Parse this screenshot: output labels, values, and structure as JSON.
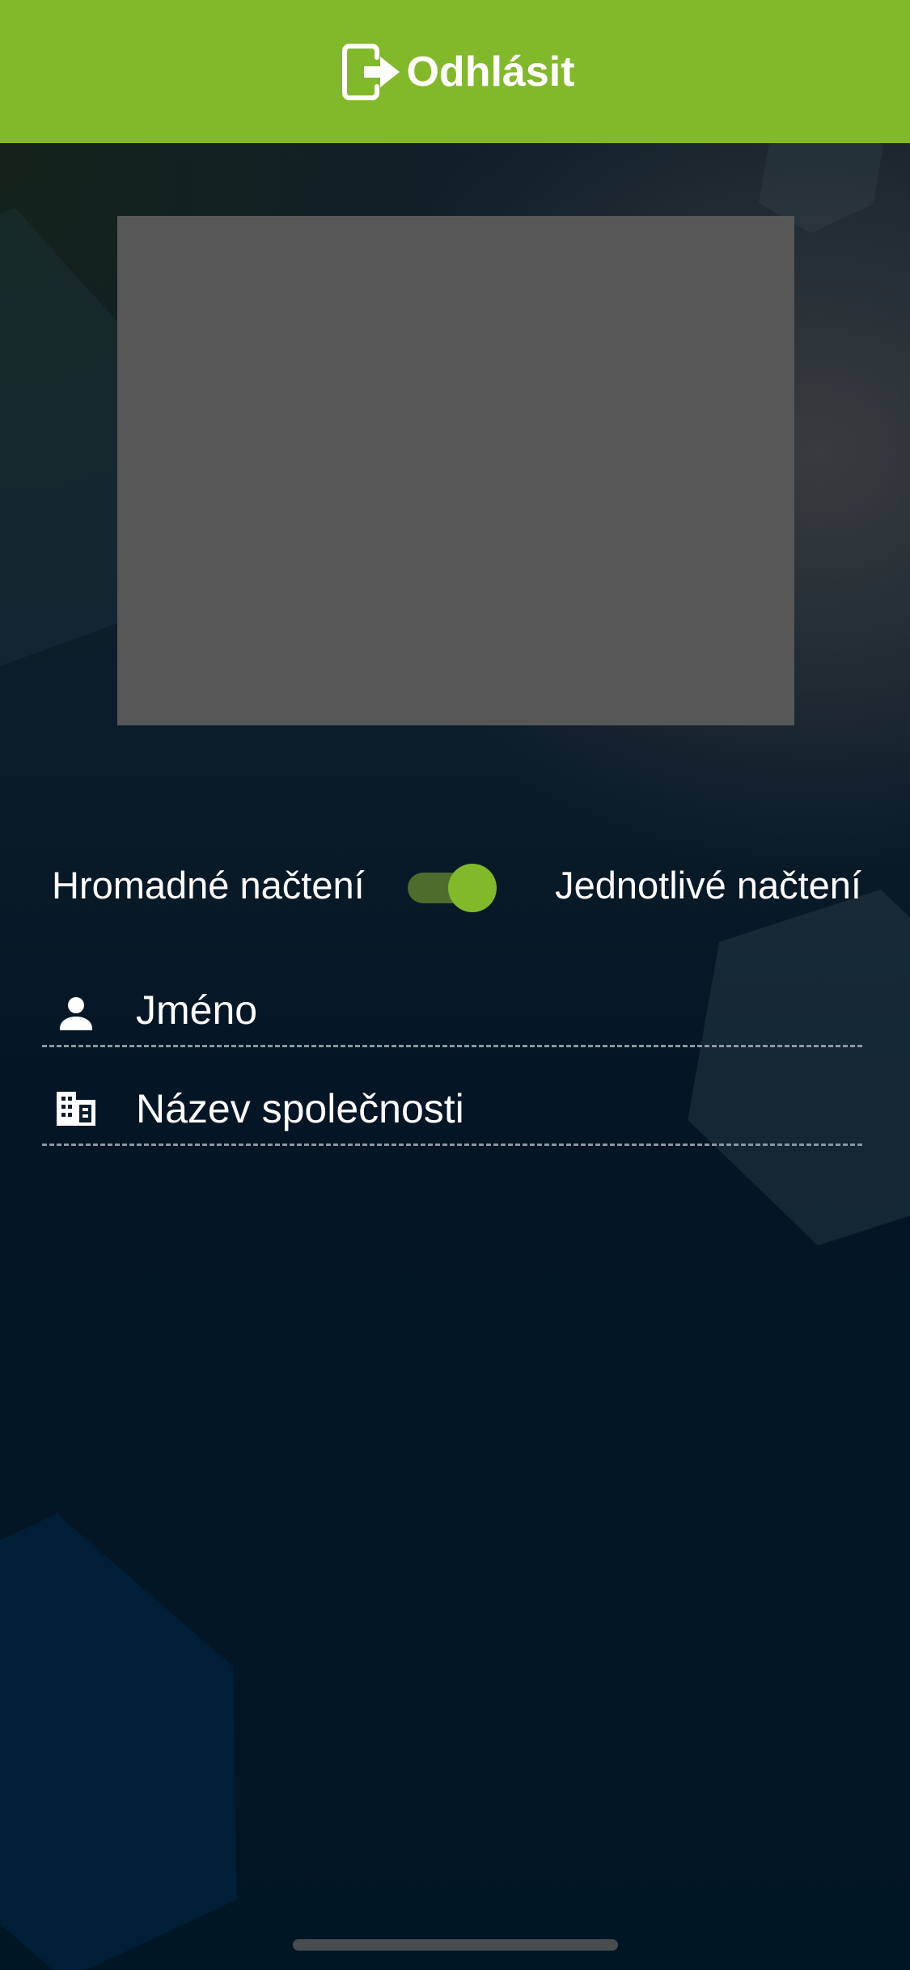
{
  "header": {
    "logout_label": "Odhlásit",
    "logout_icon": "logout-icon",
    "background_color": "#82b92a"
  },
  "scanner": {
    "preview_color": "#575757"
  },
  "mode_switch": {
    "left_label": "Hromadné načtení",
    "right_label": "Jednotlivé načtení",
    "is_on": true,
    "accent_color": "#82b92a"
  },
  "fields": {
    "name": {
      "icon": "person-icon",
      "placeholder": "Jméno",
      "value": ""
    },
    "company": {
      "icon": "building-icon",
      "placeholder": "Název společnosti",
      "value": ""
    }
  }
}
